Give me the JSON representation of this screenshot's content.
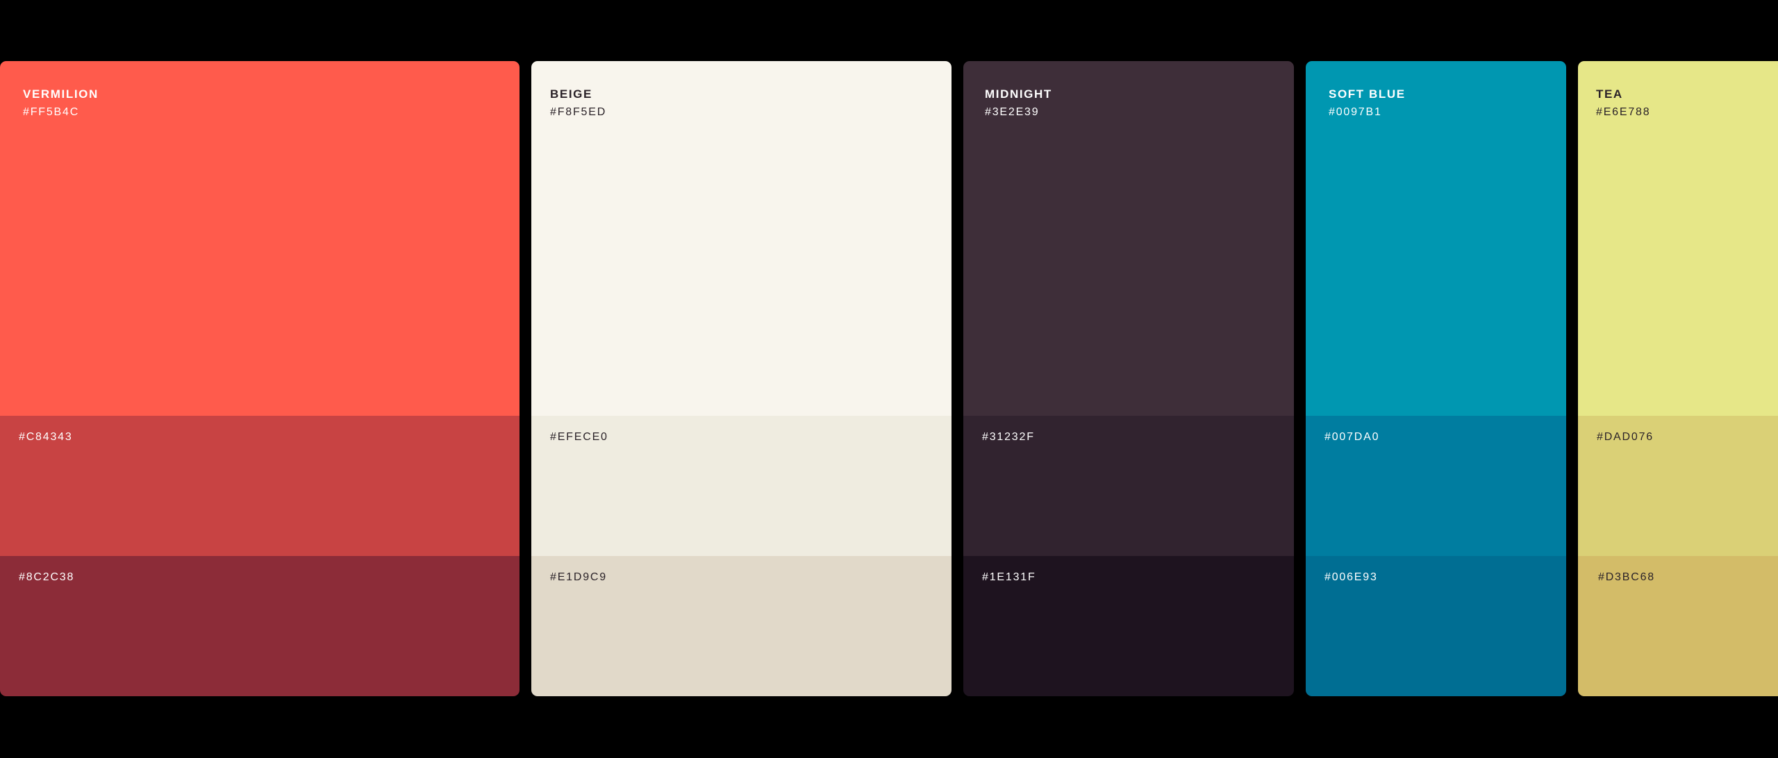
{
  "palette": [
    {
      "name": "VERMILION",
      "primary": "#FF5B4C",
      "mid": "#C84343",
      "dark": "#8C2C38",
      "text_tone": "light"
    },
    {
      "name": "BEIGE",
      "primary": "#F8F5ED",
      "mid": "#EFECE0",
      "dark": "#E1D9C9",
      "text_tone": "dark"
    },
    {
      "name": "MIDNIGHT",
      "primary": "#3E2E39",
      "mid": "#31232F",
      "dark": "#1E131F",
      "text_tone": "light"
    },
    {
      "name": "SOFT BLUE",
      "primary": "#0097B1",
      "mid": "#007DA0",
      "dark": "#006E93",
      "text_tone": "light"
    },
    {
      "name": "TEA",
      "primary": "#E6E788",
      "mid": "#DAD076",
      "dark": "#D3BC68",
      "text_tone": "dark"
    }
  ]
}
